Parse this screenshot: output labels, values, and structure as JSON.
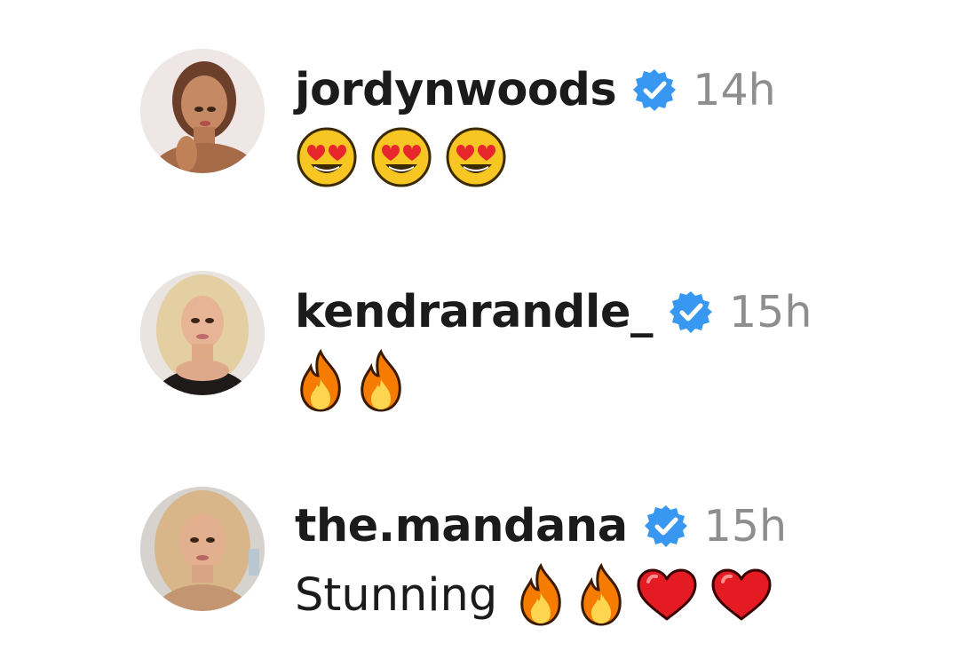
{
  "comments": [
    {
      "username": "jordynwoods",
      "verified": true,
      "time": "14h",
      "text": "",
      "emojis": [
        "heart-eyes-emoji",
        "heart-eyes-emoji",
        "heart-eyes-emoji"
      ],
      "avatar_icon": "avatar-jordynwoods"
    },
    {
      "username": "kendrarandle_",
      "verified": true,
      "time": "15h",
      "text": "",
      "emojis": [
        "fire-emoji",
        "fire-emoji"
      ],
      "avatar_icon": "avatar-kendrarandle"
    },
    {
      "username": "the.mandana",
      "verified": true,
      "time": "15h",
      "text": "Stunning",
      "emojis": [
        "fire-emoji",
        "fire-emoji",
        "red-heart-emoji",
        "red-heart-emoji"
      ],
      "avatar_icon": "avatar-themandana"
    }
  ],
  "colors": {
    "verified_badge": "#3897f0",
    "username": "#1b1b1b",
    "time": "#8e8e8e"
  }
}
